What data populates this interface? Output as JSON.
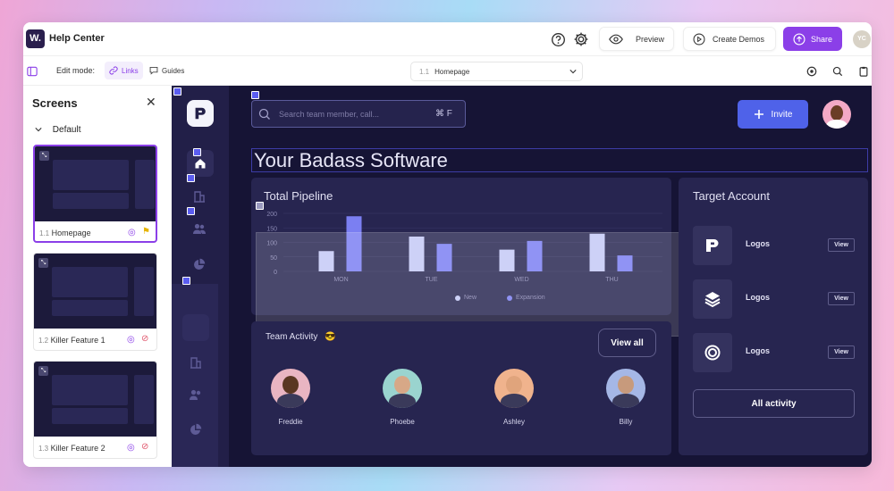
{
  "app": {
    "logo": "W.",
    "title": "Help Center"
  },
  "topbar": {
    "preview_label": "Preview",
    "create_demos_label": "Create Demos",
    "share_label": "Share",
    "avatar_initials": "YC"
  },
  "toolbar": {
    "edit_mode_label": "Edit mode:",
    "links_label": "Links",
    "guides_label": "Guides",
    "screen_select": {
      "number": "1.1",
      "name": "Homepage"
    }
  },
  "sidebar": {
    "title": "Screens",
    "group_label": "Default",
    "screens": [
      {
        "number": "1.1",
        "name": "Homepage",
        "selected": true
      },
      {
        "number": "1.2",
        "name": "Killer Feature 1",
        "selected": false
      },
      {
        "number": "1.3",
        "name": "Killer Feature 2",
        "selected": false
      }
    ]
  },
  "preview": {
    "search_placeholder": "Search team member, call...",
    "search_shortcut": "⌘ F",
    "invite_label": "Invite",
    "heading": "Your Badass Software",
    "pipeline": {
      "title": "Total Pipeline"
    },
    "team_activity": {
      "title": "Team Activity",
      "emoji": "😎",
      "view_all_label": "View all",
      "members": [
        {
          "name": "Freddie",
          "color": "#e9b5c2",
          "skin": "#5a3722"
        },
        {
          "name": "Phoebe",
          "color": "#9ad4cf",
          "skin": "#d7a887"
        },
        {
          "name": "Ashley",
          "color": "#f0b38d",
          "skin": "#e0a47c"
        },
        {
          "name": "Billy",
          "color": "#a5b7e6",
          "skin": "#c79a7c"
        }
      ]
    },
    "target_account": {
      "title": "Target Account",
      "accounts": [
        {
          "name": "Logos",
          "view_label": "View"
        },
        {
          "name": "Logos",
          "view_label": "View"
        },
        {
          "name": "Logos",
          "view_label": "View"
        }
      ],
      "all_activity_label": "All activity"
    }
  },
  "colors": {
    "accent": "#8b3fe8",
    "series_new": "#c4c9f6",
    "series_expansion": "#7b7ff2",
    "invite": "#4f62e9"
  },
  "chart_data": {
    "type": "bar",
    "categories": [
      "MON",
      "TUE",
      "WED",
      "THU"
    ],
    "series": [
      {
        "name": "New",
        "values": [
          70,
          120,
          75,
          130
        ]
      },
      {
        "name": "Expansion",
        "values": [
          190,
          95,
          105,
          55
        ]
      }
    ],
    "yticks": [
      0,
      50,
      100,
      150,
      200
    ],
    "ylim": [
      0,
      200
    ],
    "legend": "bottom"
  }
}
